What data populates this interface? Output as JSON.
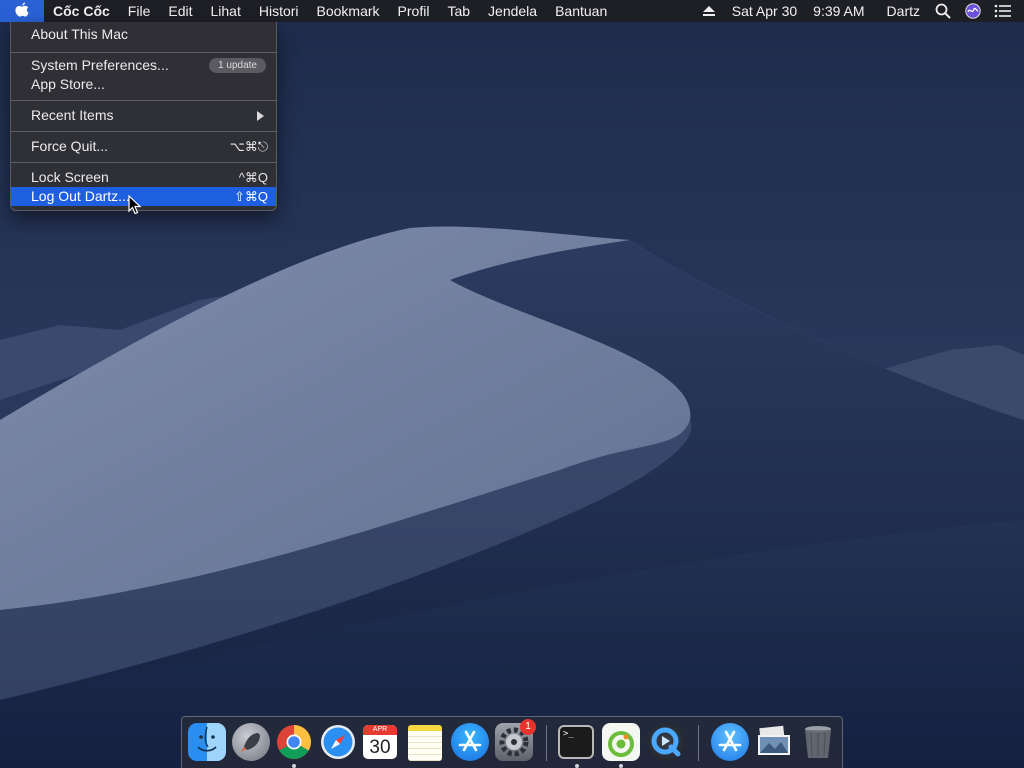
{
  "menubar": {
    "app_name": "Cốc Cốc",
    "menus": [
      "File",
      "Edit",
      "Lihat",
      "Histori",
      "Bookmark",
      "Profil",
      "Tab",
      "Jendela",
      "Bantuan"
    ],
    "clock_date": "Sat Apr 30",
    "clock_time": "9:39 AM",
    "user": "Dartz"
  },
  "apple_menu": {
    "about": "About This Mac",
    "system_prefs": "System Preferences...",
    "system_prefs_badge": "1 update",
    "app_store": "App Store...",
    "recent_items": "Recent Items",
    "force_quit": "Force Quit...",
    "force_quit_shortcut": "⌥⌘⎋",
    "lock_screen": "Lock Screen",
    "lock_screen_shortcut": "^⌘Q",
    "log_out": "Log Out Dartz...",
    "log_out_shortcut": "⇧⌘Q"
  },
  "dock": {
    "calendar_month": "APR",
    "calendar_day": "30",
    "system_prefs_badge": "1",
    "terminal_prompt": ">_"
  },
  "colors": {
    "highlight": "#1d5fe0",
    "menubar": "#1e1e22",
    "badge_red": "#e8342c"
  }
}
